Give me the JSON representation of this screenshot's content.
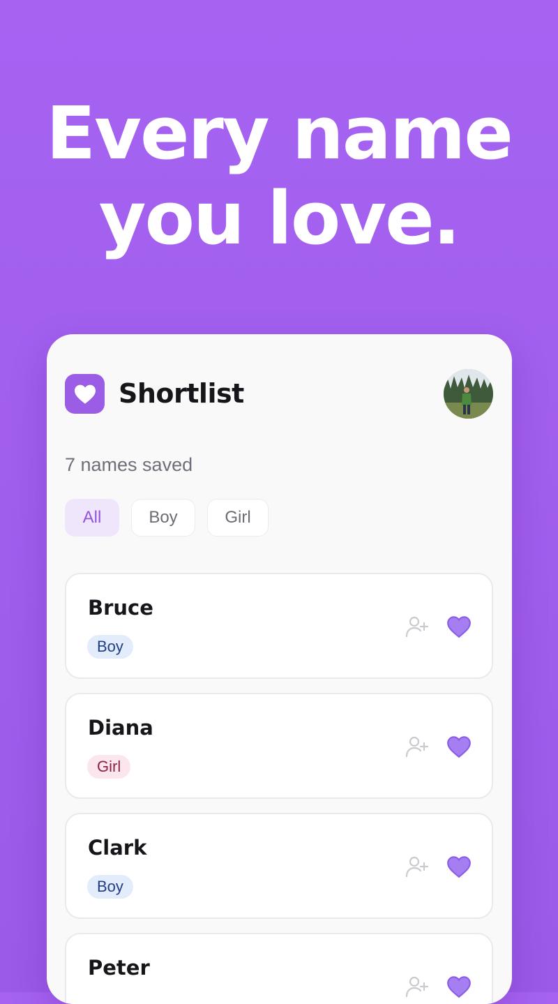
{
  "headline": {
    "line1": "Every name",
    "line2": "you love."
  },
  "app": {
    "title": "Shortlist",
    "logo_icon": "heart-icon",
    "accent": "#9b5de5"
  },
  "summary": "7 names saved",
  "filters": [
    {
      "label": "All",
      "active": true
    },
    {
      "label": "Boy",
      "active": false
    },
    {
      "label": "Girl",
      "active": false
    }
  ],
  "names": [
    {
      "name": "Bruce",
      "gender": "Boy"
    },
    {
      "name": "Diana",
      "gender": "Girl"
    },
    {
      "name": "Clark",
      "gender": "Boy"
    },
    {
      "name": "Peter",
      "gender": ""
    }
  ],
  "colors": {
    "background": "#a663f2",
    "boy_tag_bg": "#e3ecfb",
    "boy_tag_text": "#1f3c88",
    "girl_tag_bg": "#fbe6ee",
    "girl_tag_text": "#8e2148",
    "favorite_heart": "#9b6cf0"
  }
}
